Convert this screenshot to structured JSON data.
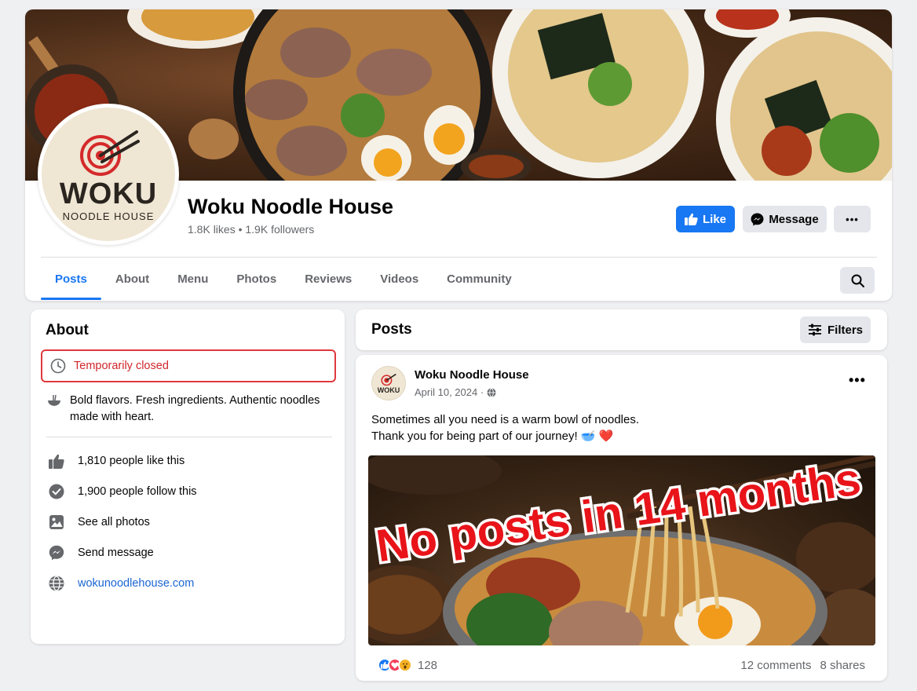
{
  "page": {
    "name": "Woku Noodle House",
    "stats": "1.8K likes • 1.9K followers",
    "avatar_word": "WOKU",
    "avatar_sub": "NOODLE HOUSE"
  },
  "actions": {
    "like_label": "Like",
    "message_label": "Message",
    "more_label": "•••"
  },
  "tabs": [
    {
      "label": "Posts",
      "active": true
    },
    {
      "label": "About"
    },
    {
      "label": "Menu"
    },
    {
      "label": "Photos"
    },
    {
      "label": "Reviews"
    },
    {
      "label": "Videos"
    },
    {
      "label": "Community"
    }
  ],
  "about": {
    "title": "About",
    "status": "Temporarily closed",
    "description": "Bold flavors. Fresh ingredients. Authentic noodles made with heart.",
    "rows": [
      {
        "icon": "thumbs-up-icon",
        "text": "1,810 people like this"
      },
      {
        "icon": "check-circle-icon",
        "text": "1,900 people follow this"
      },
      {
        "icon": "photo-icon",
        "text": "See all photos"
      },
      {
        "icon": "messenger-icon",
        "text": "Send message"
      },
      {
        "icon": "globe-icon",
        "text": "wokunoodlehouse.com"
      }
    ]
  },
  "posts": {
    "title": "Posts",
    "filters_label": "Filters"
  },
  "post": {
    "author": "Woku Noodle House",
    "date": "April 10, 2024 ·",
    "avatar_word": "WOKU",
    "line1": "Sometimes all you need is a warm bowl of noodles.",
    "line2": "Thank you for being part of our journey! 🥣 ❤️",
    "overlay": "No posts in 14 months",
    "reaction_count": "128",
    "comments": "12 comments",
    "shares": "8 shares"
  },
  "colors": {
    "accent": "#1877f2",
    "closed": "#e0393e",
    "overlay": "#e8141a"
  }
}
